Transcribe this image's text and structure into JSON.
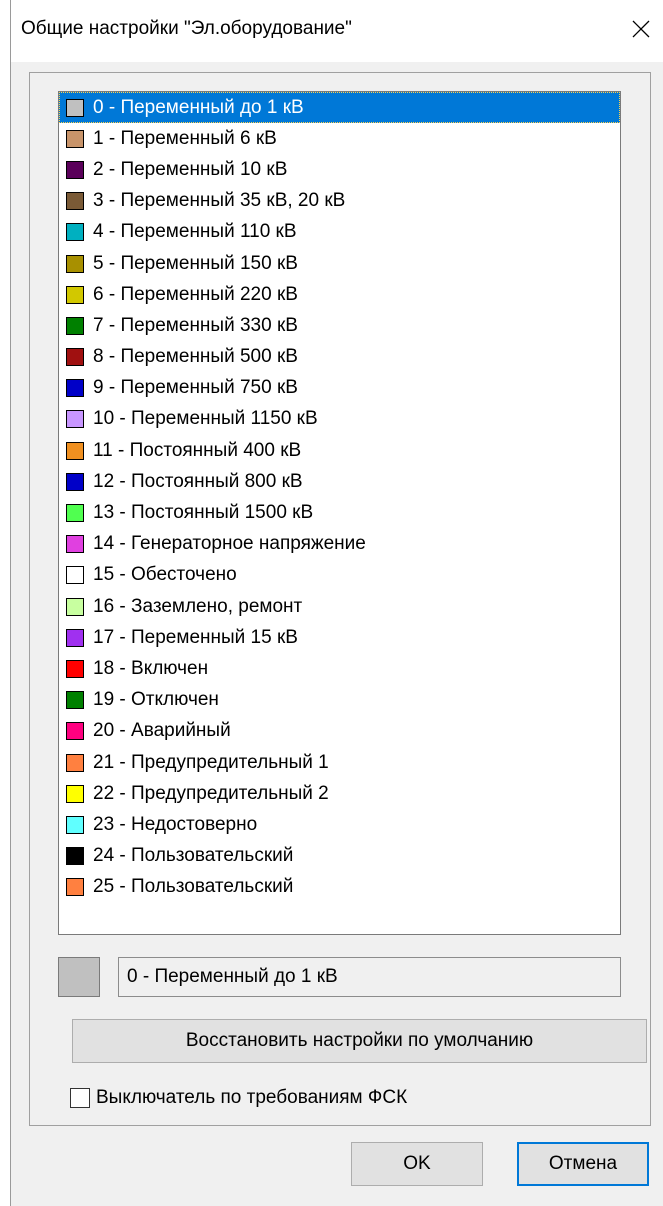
{
  "window": {
    "title": "Общие настройки \"Эл.оборудование\"",
    "close_icon": "close-icon"
  },
  "list": {
    "selected_index": 0,
    "selection_color": "#0078d7",
    "items": [
      {
        "label": "0 - Переменный до 1 кВ",
        "color": "#c0c0c0"
      },
      {
        "label": "1 - Переменный 6 кВ",
        "color": "#c8946a"
      },
      {
        "label": "2 - Переменный 10 кВ",
        "color": "#5a005a"
      },
      {
        "label": "3 - Переменный 35 кВ, 20 кВ",
        "color": "#7a5a36"
      },
      {
        "label": "4 - Переменный 110 кВ",
        "color": "#00b0c0"
      },
      {
        "label": "5 - Переменный 150 кВ",
        "color": "#a89000"
      },
      {
        "label": "6 - Переменный 220 кВ",
        "color": "#d2c800"
      },
      {
        "label": "7 - Переменный 330 кВ",
        "color": "#008000"
      },
      {
        "label": "8 - Переменный 500 кВ",
        "color": "#a01010"
      },
      {
        "label": "9 - Переменный 750 кВ",
        "color": "#0000c8"
      },
      {
        "label": "10 - Переменный 1150 кВ",
        "color": "#c896ff"
      },
      {
        "label": "11 - Постоянный 400 кВ",
        "color": "#f09020"
      },
      {
        "label": "12 - Постоянный 800 кВ",
        "color": "#0000c8"
      },
      {
        "label": "13 - Постоянный 1500 кВ",
        "color": "#50ff50"
      },
      {
        "label": "14 - Генераторное напряжение",
        "color": "#e040e0"
      },
      {
        "label": "15 - Обесточено",
        "color": "#ffffff"
      },
      {
        "label": "16 - Заземлено, ремонт",
        "color": "#c8ffa0"
      },
      {
        "label": "17 - Переменный 15 кВ",
        "color": "#a030f0"
      },
      {
        "label": "18 - Включен",
        "color": "#ff0000"
      },
      {
        "label": "19 - Отключен",
        "color": "#008000"
      },
      {
        "label": "20 - Аварийный",
        "color": "#ff0080"
      },
      {
        "label": "21 - Предупредительный 1",
        "color": "#ff8040"
      },
      {
        "label": "22 - Предупредительный 2",
        "color": "#ffff00"
      },
      {
        "label": "23 - Недостоверно",
        "color": "#60ffff"
      },
      {
        "label": "24 - Пользовательский",
        "color": "#000000"
      },
      {
        "label": "25 - Пользовательский",
        "color": "#ff8040"
      }
    ]
  },
  "preview": {
    "color": "#c0c0c0",
    "value": "0 - Переменный до 1 кВ"
  },
  "restore_button": {
    "label": "Восстановить настройки по умолчанию"
  },
  "checkbox": {
    "label": "Выключатель по требованиям ФСК",
    "checked": false
  },
  "ok_button": {
    "label": "OK"
  },
  "cancel_button": {
    "label": "Отмена"
  }
}
